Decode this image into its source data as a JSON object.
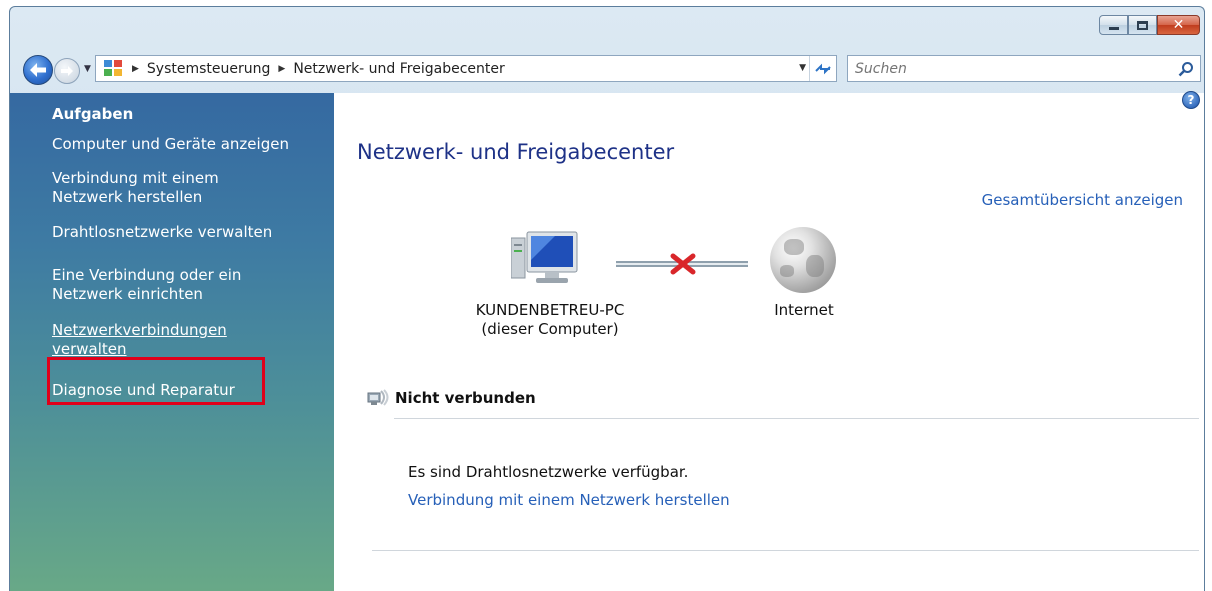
{
  "window": {
    "buttons": {
      "minimize": "–",
      "maximize": "□",
      "close": "✕"
    }
  },
  "nav": {
    "breadcrumbs": [
      "Systemsteuerung",
      "Netzwerk- und Freigabecenter"
    ],
    "search_placeholder": "Suchen"
  },
  "sidebar": {
    "heading": "Aufgaben",
    "items": [
      {
        "label": "Computer und Geräte anzeigen"
      },
      {
        "label": "Verbindung mit einem Netzwerk herstellen"
      },
      {
        "label": "Drahtlosnetzwerke verwalten"
      },
      {
        "label": "Eine Verbindung oder ein Netzwerk einrichten"
      },
      {
        "label": "Netzwerkverbindungen verwalten"
      },
      {
        "label": "Diagnose und Reparatur"
      }
    ]
  },
  "main": {
    "title": "Netzwerk- und Freigabecenter",
    "overview_link": "Gesamtübersicht anzeigen",
    "computer_name": "KUNDENBETREU-PC",
    "computer_subtitle": "(dieser Computer)",
    "internet_label": "Internet",
    "section_title": "Nicht verbunden",
    "status_text": "Es sind Drahtlosnetzwerke verfügbar.",
    "connect_link": "Verbindung mit einem Netzwerk herstellen",
    "help_glyph": "?"
  },
  "colors": {
    "link": "#2760b8",
    "title": "#1e3287",
    "highlight": "#e0001a",
    "sidebar_top": "#3569a1",
    "sidebar_bottom": "#6aaa86"
  }
}
